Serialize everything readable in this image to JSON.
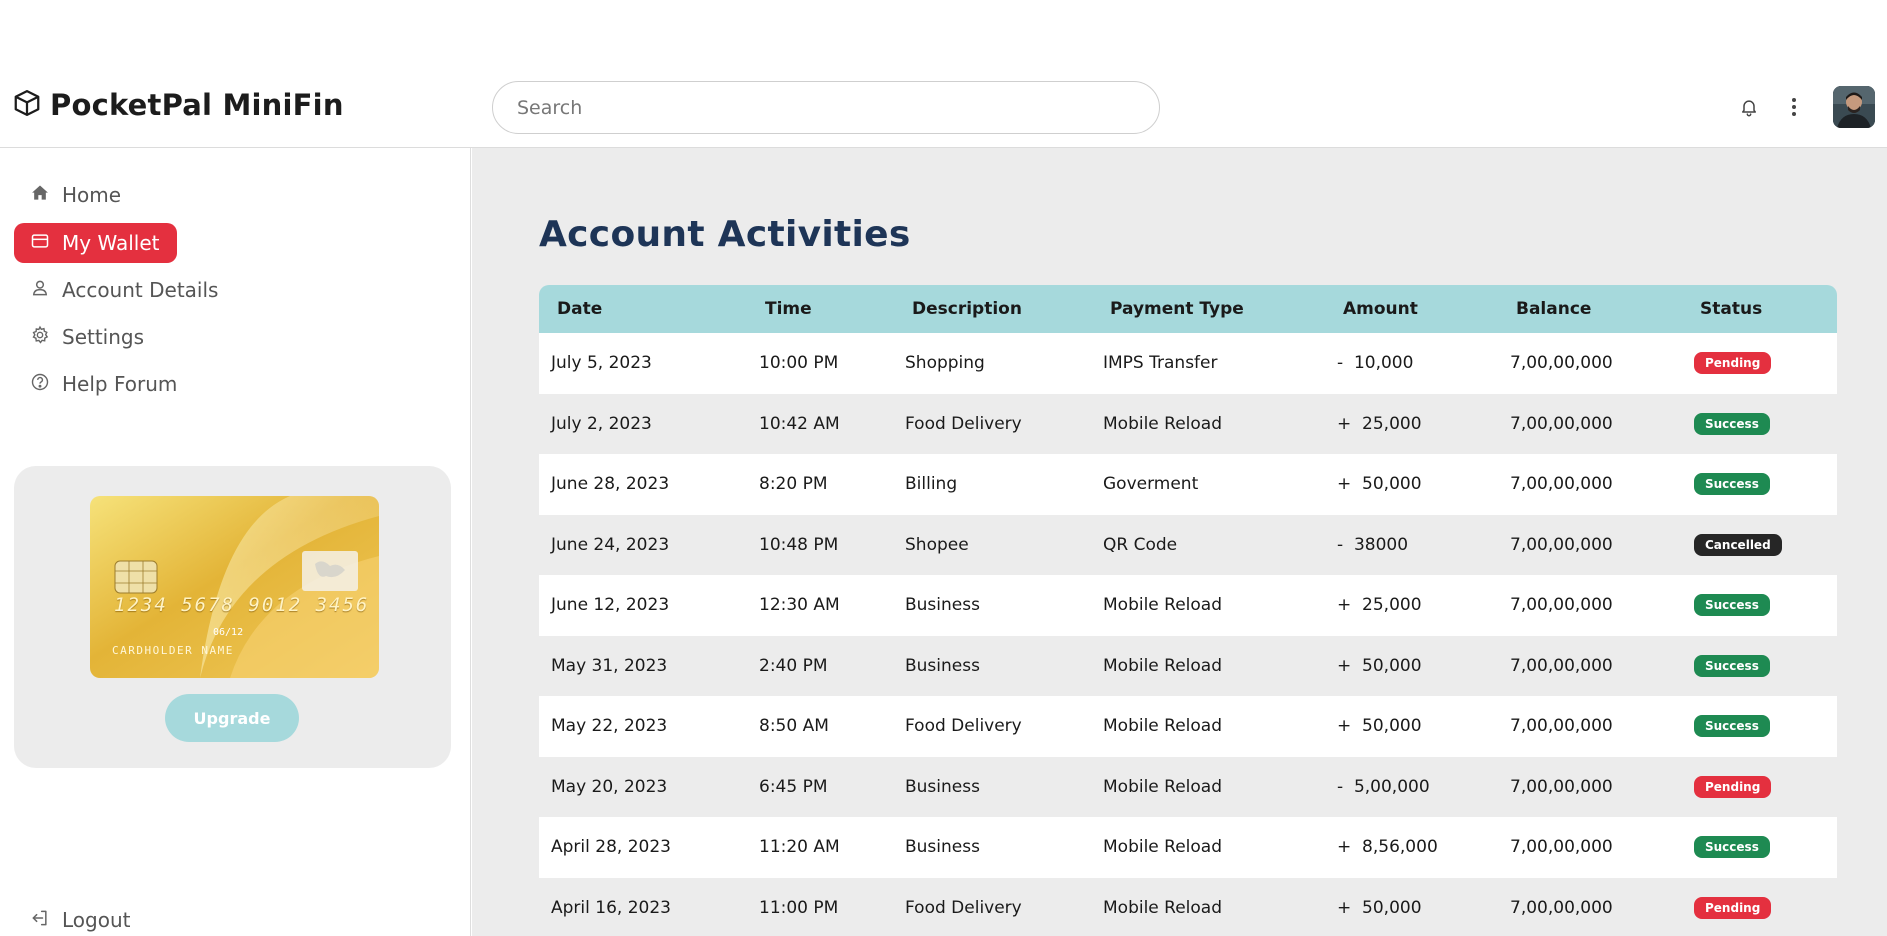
{
  "app": {
    "brand": "PocketPal MiniFin"
  },
  "header": {
    "search_placeholder": "Search",
    "icons": [
      "bell-icon",
      "more-vertical-icon"
    ]
  },
  "sidebar": {
    "items": [
      {
        "label": "Home",
        "icon": "home-icon"
      },
      {
        "label": "My Wallet",
        "icon": "wallet-icon",
        "active": true
      },
      {
        "label": "Account Details",
        "icon": "user-icon"
      },
      {
        "label": "Settings",
        "icon": "gear-icon"
      },
      {
        "label": "Help Forum",
        "icon": "help-icon"
      }
    ],
    "logout": {
      "label": "Logout",
      "icon": "logout-icon"
    },
    "promo": {
      "card_number": "1234 5678 9012 3456",
      "card_expiry": "06/12",
      "card_holder": "CARDHOLDER NAME",
      "upgrade_label": "Upgrade"
    }
  },
  "main": {
    "title": "Account Activities",
    "columns": [
      "Date",
      "Time",
      "Description",
      "Payment Type",
      "Amount",
      "Balance",
      "Status"
    ],
    "rows": [
      {
        "date": "July 5, 2023",
        "time": "10:00 PM",
        "description": "Shopping",
        "type": "IMPS Transfer",
        "amount": "-  10,000",
        "balance": "7,00,00,000",
        "status": "Pending"
      },
      {
        "date": "July 2, 2023",
        "time": "10:42 AM",
        "description": "Food Delivery",
        "type": "Mobile Reload",
        "amount": "+  25,000",
        "balance": "7,00,00,000",
        "status": "Success"
      },
      {
        "date": "June 28, 2023",
        "time": "8:20 PM",
        "description": "Billing",
        "type": "Goverment",
        "amount": "+  50,000",
        "balance": "7,00,00,000",
        "status": "Success"
      },
      {
        "date": "June 24, 2023",
        "time": "10:48 PM",
        "description": "Shopee",
        "type": "QR Code",
        "amount": "-  38000",
        "balance": "7,00,00,000",
        "status": "Cancelled"
      },
      {
        "date": "June 12, 2023",
        "time": "12:30 AM",
        "description": "Business",
        "type": "Mobile Reload",
        "amount": "+  25,000",
        "balance": "7,00,00,000",
        "status": "Success"
      },
      {
        "date": "May 31, 2023",
        "time": "2:40 PM",
        "description": "Business",
        "type": "Mobile Reload",
        "amount": "+  50,000",
        "balance": "7,00,00,000",
        "status": "Success"
      },
      {
        "date": "May 22, 2023",
        "time": "8:50 AM",
        "description": "Food Delivery",
        "type": "Mobile Reload",
        "amount": "+  50,000",
        "balance": "7,00,00,000",
        "status": "Success"
      },
      {
        "date": "May 20, 2023",
        "time": "6:45 PM",
        "description": "Business",
        "type": "Mobile Reload",
        "amount": "-  5,00,000",
        "balance": "7,00,00,000",
        "status": "Pending"
      },
      {
        "date": "April 28, 2023",
        "time": "11:20 AM",
        "description": "Business",
        "type": "Mobile Reload",
        "amount": "+  8,56,000",
        "balance": "7,00,00,000",
        "status": "Success"
      },
      {
        "date": "April 16, 2023",
        "time": "11:00 PM",
        "description": "Food Delivery",
        "type": "Mobile Reload",
        "amount": "+  50,000",
        "balance": "7,00,00,000",
        "status": "Pending"
      }
    ]
  },
  "colors": {
    "accent_red": "#e4303f",
    "table_header": "#a6d9dc",
    "title_navy": "#1e3557",
    "success_green": "#1e8a52",
    "cancelled_dark": "#262626"
  }
}
